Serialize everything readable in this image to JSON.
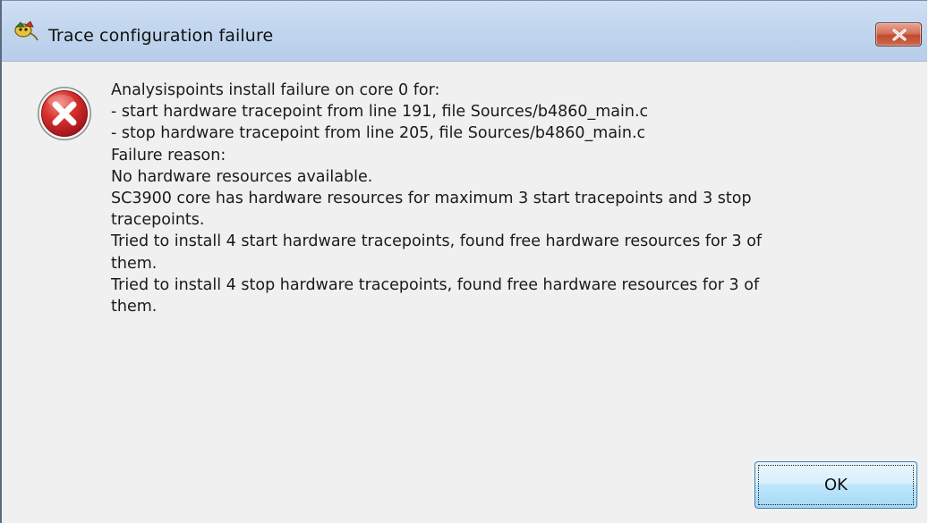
{
  "window": {
    "title": "Trace configuration failure",
    "title_icon": "application-icon",
    "close_icon": "close-icon",
    "accent_close": "#c24a2f"
  },
  "dialog": {
    "icon": "error-icon",
    "icon_color": "#c8242a",
    "message_lines": [
      "Analysispoints install failure on core 0 for:",
      "- start hardware tracepoint from line 191, file Sources/b4860_main.c",
      "- stop hardware tracepoint from line 205, file Sources/b4860_main.c",
      "Failure reason:",
      "No hardware resources available.",
      "SC3900 core has hardware resources for maximum 3 start tracepoints and 3 stop",
      "tracepoints.",
      "Tried to install 4 start hardware tracepoints, found free hardware resources for 3 of",
      "them.",
      "Tried to install 4 stop hardware tracepoints, found free hardware resources for 3 of",
      "them."
    ],
    "ok_label": "OK"
  }
}
